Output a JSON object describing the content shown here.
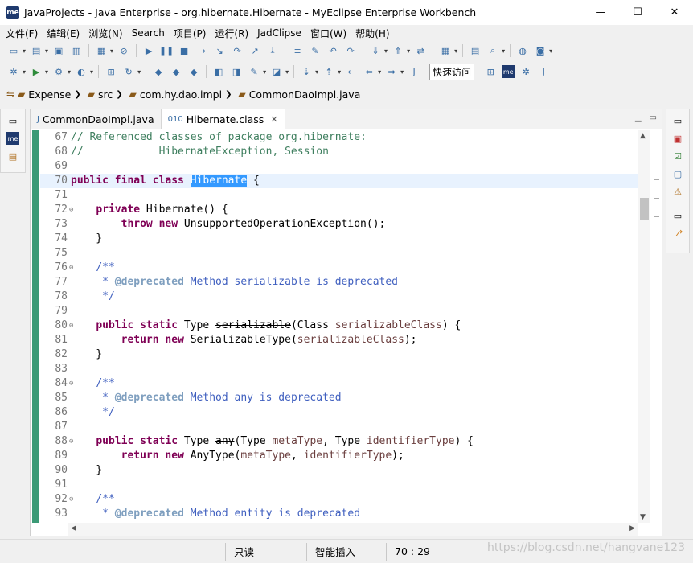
{
  "window": {
    "title": "JavaProjects - Java Enterprise - org.hibernate.Hibernate - MyEclipse Enterprise Workbench",
    "logo": "me"
  },
  "menu": [
    "文件(F)",
    "编辑(E)",
    "浏览(N)",
    "Search",
    "项目(P)",
    "运行(R)",
    "JadClipse",
    "窗口(W)",
    "帮助(H)"
  ],
  "toolbar": {
    "quick_access": "快速访问"
  },
  "breadcrumb": [
    {
      "icon": "folder-icon",
      "label": "Expense"
    },
    {
      "icon": "package-folder-icon",
      "label": "src"
    },
    {
      "icon": "package-icon",
      "label": "com.hy.dao.impl"
    },
    {
      "icon": "java-file-icon",
      "label": "CommonDaoImpl.java"
    }
  ],
  "tabs": [
    {
      "label": "CommonDaoImpl.java",
      "active": false
    },
    {
      "label": "Hibernate.class",
      "active": true
    }
  ],
  "code": {
    "line_numbers": [
      "67",
      "68",
      "69",
      "70",
      "71",
      "72",
      "73",
      "74",
      "75",
      "76",
      "77",
      "78",
      "79",
      "80",
      "81",
      "82",
      "83",
      "84",
      "85",
      "86",
      "87",
      "88",
      "89",
      "90",
      "91",
      "92",
      "93"
    ],
    "selected_word": "Hibernate"
  },
  "status": {
    "mode": "只读",
    "insert": "智能插入",
    "position": "70 : 29"
  },
  "watermark": "https://blog.csdn.net/hangvane123",
  "colors": {
    "keyword": "#7f0055",
    "comment": "#3f5fbf",
    "gutter": "#3c9a76",
    "selection": "#3399ff"
  }
}
